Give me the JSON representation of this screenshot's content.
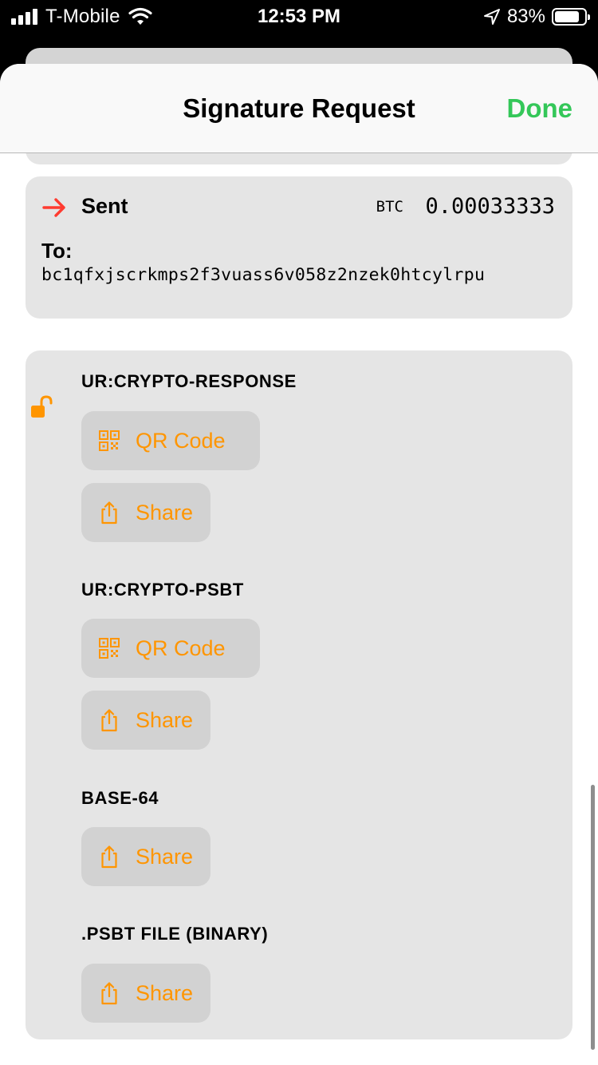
{
  "status_bar": {
    "carrier": "T-Mobile",
    "time": "12:53 PM",
    "battery": "83%",
    "battery_level": 0.83
  },
  "nav": {
    "title": "Signature Request",
    "done_label": "Done"
  },
  "transaction": {
    "direction": "Sent",
    "currency": "BTC",
    "amount": "0.00033333",
    "to_label": "To:",
    "address": "bc1qfxjscrkmps2f3vuass6v058z2nzek0htcylrpu"
  },
  "export": {
    "sections": [
      {
        "title": "UR:CRYPTO-RESPONSE",
        "qr_label": "QR Code",
        "share_label": "Share"
      },
      {
        "title": "UR:CRYPTO-PSBT",
        "qr_label": "QR Code",
        "share_label": "Share"
      },
      {
        "title": "BASE-64",
        "share_label": "Share"
      },
      {
        "title": ".PSBT FILE (BINARY)",
        "share_label": "Share"
      }
    ]
  },
  "colors": {
    "accent": "#ff9500",
    "done": "#34c759",
    "sent_arrow": "#ff3b30",
    "card": "#e5e5e5",
    "button": "#d2d2d2"
  },
  "icons": [
    "signal-icon",
    "wifi-icon",
    "location-icon",
    "battery-icon",
    "arrow-right-icon",
    "lock-open-icon",
    "qr-code-icon",
    "share-icon"
  ]
}
